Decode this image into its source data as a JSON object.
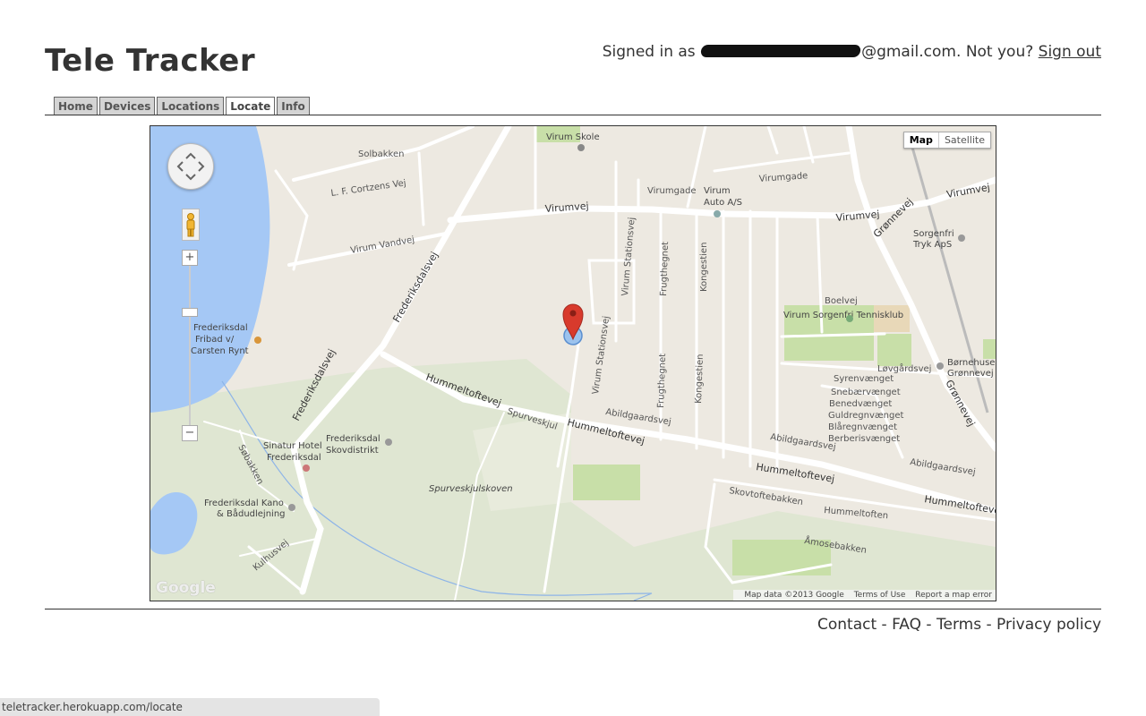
{
  "header": {
    "title": "Tele Tracker",
    "signed_in_prefix": "Signed in as",
    "email_suffix": "@gmail.com.",
    "not_you": "Not you?",
    "sign_out": "Sign out"
  },
  "nav": {
    "tabs": [
      {
        "label": "Home",
        "active": false
      },
      {
        "label": "Devices",
        "active": false
      },
      {
        "label": "Locations",
        "active": false
      },
      {
        "label": "Locate",
        "active": true
      },
      {
        "label": "Info",
        "active": false
      }
    ]
  },
  "map": {
    "type_toggle": {
      "map": "Map",
      "satellite": "Satellite",
      "selected": "Map"
    },
    "zoom_in": "+",
    "zoom_out": "−",
    "google_logo": "Google",
    "attribution": {
      "data": "Map data ©2013 Google",
      "terms": "Terms of Use",
      "report": "Report a map error"
    },
    "colors": {
      "land": "#ede9e1",
      "water": "#a5c8f5",
      "park": "#c8dfa8",
      "forest": "#dfe6d2",
      "road": "#ffffff",
      "marker": "#d83a2c"
    },
    "labels": {
      "virum_skole": "Virum Skole",
      "virum_auto_1": "Virum",
      "virum_auto_2": "Auto A/S",
      "sorgenfri_1": "Sorgenfri",
      "sorgenfri_2": "Tryk ApS",
      "tennis": "Virum Sorgenfri Tennisklub",
      "bornehuse_1": "Børnehuse",
      "bornehuse_2": "Grønnevej",
      "fribad_1": "Frederiksdal",
      "fribad_2": "Fribad v/",
      "fribad_3": "Carsten Rynt",
      "skov_1": "Frederiksdal",
      "skov_2": "Skovdistrikt",
      "hotel_1": "Sinatur Hotel",
      "hotel_2": "Frederiksdal",
      "kano_1": "Frederiksdal Kano",
      "kano_2": "& Bådudlejning",
      "spurveskjulskoven": "Spurveskjulskoven"
    },
    "roads": {
      "solbakken": "Solbakken",
      "cortzen": "L. F. Cortzens Vej",
      "virum_vandvej": "Virum Vandvej",
      "frederiksdalsvej": "Frederiksdalsvej",
      "hummeltoftevej": "Hummeltoftevej",
      "virumvej": "Virumvej",
      "virumgade": "Virumgade",
      "gronnevej": "Grønnevej",
      "abildgaardsvej": "Abildgaardsvej",
      "lovgardsvej": "Løvgårdsvej",
      "syrenvaenget": "Syrenvænget",
      "snebaervaenget": "Snebærvænget",
      "bendvaenget": "Benedvænget",
      "guldregnvaenget": "Guldregnvænget",
      "blaregnvaenget": "Blåregnvænget",
      "berberisvaenget": "Berberisvænget",
      "skovtoftebakken": "Skovtoftebakken",
      "hummeltoften": "Hummeltoften",
      "amosebakken": "Åmosebakken",
      "spurveskjul": "Spurveskjul",
      "sobakken": "Søbakken",
      "kulhusvej": "Kulhusvej",
      "boelvej": "Boelvej",
      "virum_stationsvej": "Virum Stationsvej",
      "kongestien": "Kongestien",
      "frugthegnet": "Frugthegnet"
    }
  },
  "footer": {
    "contact": "Contact",
    "faq": "FAQ",
    "terms": "Terms",
    "privacy": "Privacy policy",
    "sep": " - "
  },
  "status_url": "teletracker.herokuapp.com/locate"
}
